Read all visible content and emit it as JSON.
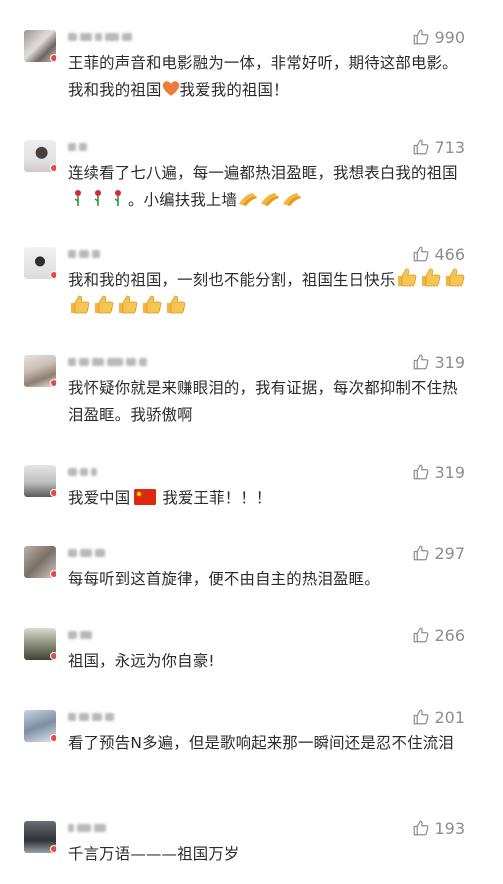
{
  "comments": [
    {
      "likes": "990",
      "text_a": "王菲的声音和电影融为一体，非常好听，期待这部电影。我和我的祖国",
      "emoji_a": "heart-emoji",
      "text_b": "我爱我的祖国！"
    },
    {
      "likes": "713",
      "text_a": "连续看了七八遍，每一遍都热泪盈眶，我想表白我的祖国",
      "emoji_a": "rose-emoji",
      "emoji_count_a": 3,
      "text_b": "。小编扶我上墙",
      "emoji_b": "clap-emoji",
      "emoji_count_b": 3
    },
    {
      "likes": "466",
      "text_a": "我和我的祖国，一刻也不能分割，祖国生日快乐",
      "emoji_a": "thumbs-up-emoji",
      "emoji_count_a": 8
    },
    {
      "likes": "319",
      "text_a": "我怀疑你就是来赚眼泪的，我有证据，每次都抑制不住热泪盈眶。我骄傲啊"
    },
    {
      "likes": "319",
      "text_a": "我爱中国",
      "emoji_a": "china-flag-emoji",
      "text_b": "我爱王菲！！！"
    },
    {
      "likes": "297",
      "text_a": "每每听到这首旋律，便不由自主的热泪盈眶。"
    },
    {
      "likes": "266",
      "text_a": "祖国，永远为你自豪!"
    },
    {
      "likes": "201",
      "text_a": "看了预告N多遍，但是歌响起来那一瞬间还是忍不住流泪"
    },
    {
      "likes": "193",
      "text_a": "千言万语———祖国万岁"
    }
  ],
  "colors": {
    "text": "#2b2b2b",
    "likes": "#8d8d8d",
    "badge": "#e8483d",
    "heart": "#f07a3a",
    "flag": "#de2910"
  },
  "icons": {
    "like": "thumbs-up-icon"
  }
}
